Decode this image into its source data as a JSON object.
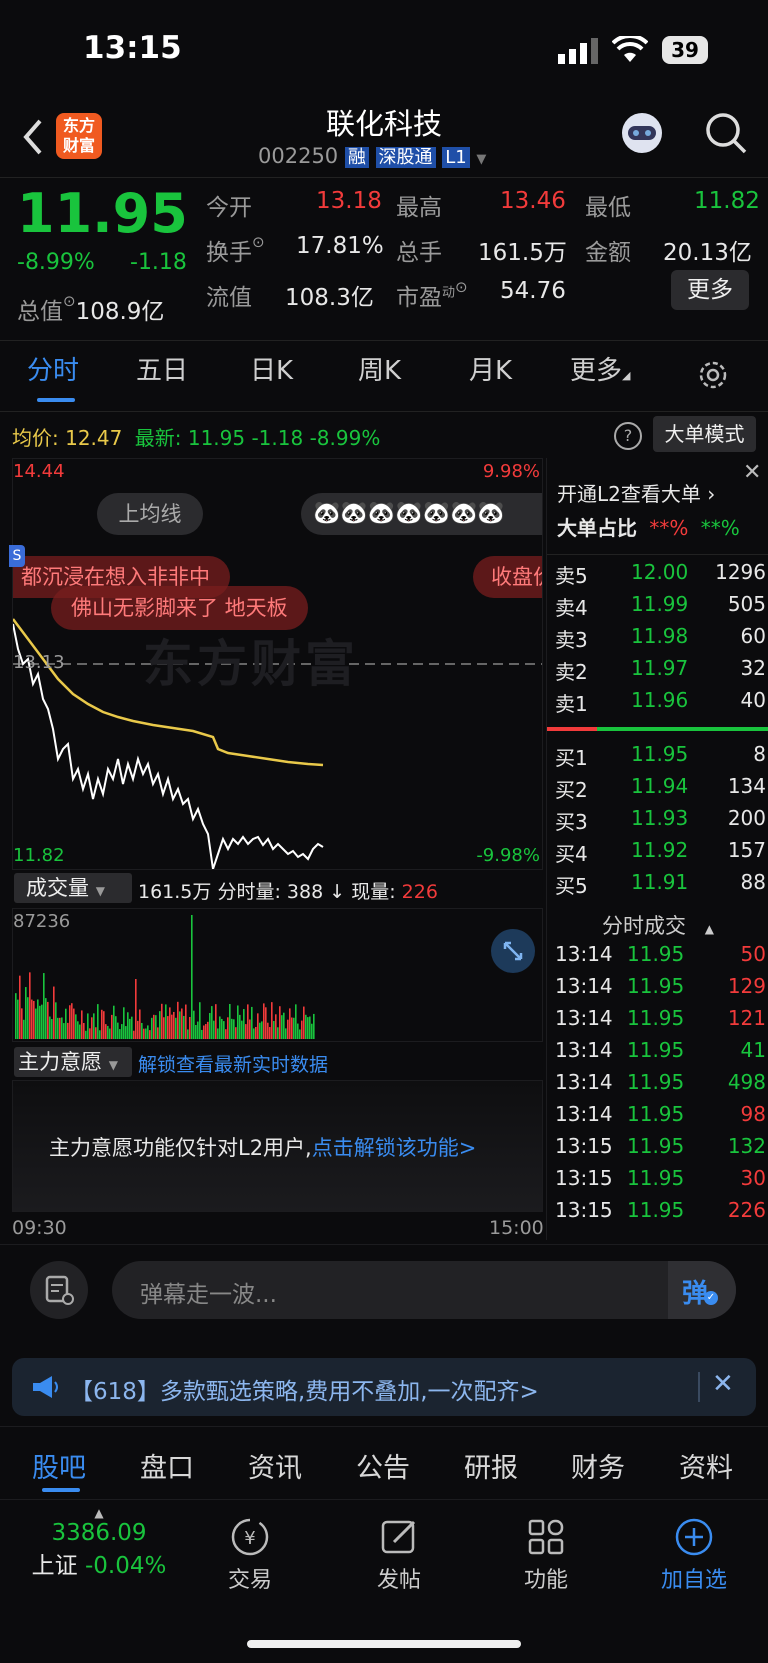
{
  "status_bar": {
    "time": "13:15",
    "battery": "39"
  },
  "header": {
    "logo_line1": "东方",
    "logo_line2": "财富",
    "title": "联化科技",
    "code": "002250",
    "tags": [
      "融",
      "深股通",
      "L1"
    ]
  },
  "quote": {
    "price": "11.95",
    "pct": "-8.99%",
    "change": "-1.18",
    "market_cap_label": "总值",
    "market_cap": "108.9亿",
    "stats": [
      {
        "label": "今开",
        "value": "13.18",
        "color": "red"
      },
      {
        "label": "最高",
        "value": "13.46",
        "color": "red"
      },
      {
        "label": "最低",
        "value": "11.82",
        "color": "green"
      },
      {
        "label": "换手",
        "value": "17.81%",
        "color": "white"
      },
      {
        "label": "总手",
        "value": "161.5万",
        "color": "white"
      },
      {
        "label": "金额",
        "value": "20.13亿",
        "color": "white"
      },
      {
        "label": "流值",
        "value": "108.3亿",
        "color": "white"
      },
      {
        "label": "市盈",
        "value": "54.76",
        "color": "white"
      }
    ],
    "pe_sup": "动",
    "more_button": "更多"
  },
  "tabs": [
    "分时",
    "五日",
    "日K",
    "周K",
    "月K",
    "更多"
  ],
  "chart_info": {
    "avg_label": "均价:",
    "avg": "12.47",
    "latest_label": "最新:",
    "latest": "11.95",
    "chg": "-1.18",
    "pct": "-8.99%",
    "big_order_button": "大单模式"
  },
  "chart": {
    "y_max": "14.44",
    "y_min": "11.82",
    "pct_max": "9.98%",
    "pct_min": "-9.98%",
    "prev_close": "13.13",
    "avg_line_button": "上均线",
    "danmaku": [
      "都沉浸在想入非非中",
      "佛山无影脚来了 地天板",
      "收盘价"
    ],
    "emoji_row": "🐼🐼🐼🐼🐼🐼🐼",
    "watermark": "东方财富",
    "time_start": "09:30",
    "time_end": "15:00"
  },
  "volume": {
    "label": "成交量",
    "total": "161.5万",
    "minute_label": "分时量:",
    "minute": "388",
    "arrow": "↓",
    "now_label": "现量:",
    "now": "226",
    "max": "87236"
  },
  "main_will": {
    "label": "主力意愿",
    "unlock": "解锁查看最新实时数据",
    "msg": "主力意愿功能仅针对L2用户,",
    "msg_link": "点击解锁该功能>"
  },
  "order_book": {
    "l2_promo": "开通L2查看大单 ›",
    "big_ratio_label": "大单占比",
    "big_ratio_buy": "**%",
    "big_ratio_sell": "**%",
    "asks": [
      {
        "label": "卖5",
        "price": "12.00",
        "vol": "1296"
      },
      {
        "label": "卖4",
        "price": "11.99",
        "vol": "505"
      },
      {
        "label": "卖3",
        "price": "11.98",
        "vol": "60"
      },
      {
        "label": "卖2",
        "price": "11.97",
        "vol": "32"
      },
      {
        "label": "卖1",
        "price": "11.96",
        "vol": "40"
      }
    ],
    "bids": [
      {
        "label": "买1",
        "price": "11.95",
        "vol": "8"
      },
      {
        "label": "买2",
        "price": "11.94",
        "vol": "134"
      },
      {
        "label": "买3",
        "price": "11.93",
        "vol": "200"
      },
      {
        "label": "买4",
        "price": "11.92",
        "vol": "157"
      },
      {
        "label": "买5",
        "price": "11.91",
        "vol": "88"
      }
    ],
    "ticks_title": "分时成交",
    "ticks": [
      {
        "time": "13:14",
        "price": "11.95",
        "vol": "50",
        "color": "red"
      },
      {
        "time": "13:14",
        "price": "11.95",
        "vol": "129",
        "color": "red"
      },
      {
        "time": "13:14",
        "price": "11.95",
        "vol": "121",
        "color": "red"
      },
      {
        "time": "13:14",
        "price": "11.95",
        "vol": "41",
        "color": "green"
      },
      {
        "time": "13:14",
        "price": "11.95",
        "vol": "498",
        "color": "green"
      },
      {
        "time": "13:14",
        "price": "11.95",
        "vol": "98",
        "color": "red"
      },
      {
        "time": "13:15",
        "price": "11.95",
        "vol": "132",
        "color": "green"
      },
      {
        "time": "13:15",
        "price": "11.95",
        "vol": "30",
        "color": "red"
      },
      {
        "time": "13:15",
        "price": "11.95",
        "vol": "226",
        "color": "red"
      }
    ]
  },
  "comment": {
    "placeholder": "弹幕走一波...",
    "send_label": "弹"
  },
  "ad": {
    "text": "【618】多款甄选策略,费用不叠加,一次配齐>"
  },
  "bottom_tabs": [
    "股吧",
    "盘口",
    "资讯",
    "公告",
    "研报",
    "财务",
    "资料"
  ],
  "footer": {
    "index_value": "3386.09",
    "index_name": "上证",
    "index_pct": "-0.04%",
    "trade": "交易",
    "post": "发帖",
    "func": "功能",
    "add": "加自选"
  },
  "colors": {
    "up": "#f23b3b",
    "down": "#19c43d",
    "accent": "#3a8cf0",
    "avg_line": "#e9c94a"
  }
}
